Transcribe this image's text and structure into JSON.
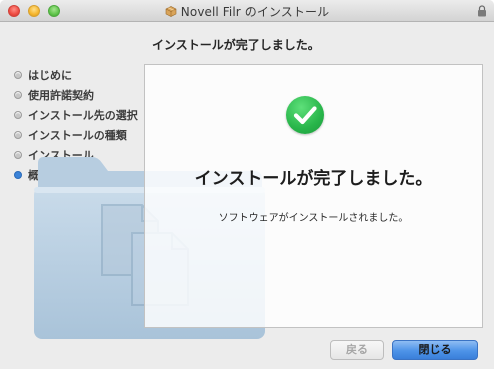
{
  "window": {
    "title": "Novell Filr のインストール",
    "icons": {
      "app": "package-icon",
      "lock": "lock-icon"
    }
  },
  "main": {
    "heading": "インストールが完了しました。",
    "completion_title": "インストールが完了しました。",
    "completion_message": "ソフトウェアがインストールされました。",
    "status_icon": "checkmark-icon"
  },
  "sidebar": {
    "steps": [
      {
        "label": "はじめに",
        "active": false
      },
      {
        "label": "使用許諾契約",
        "active": false
      },
      {
        "label": "インストール先の選択",
        "active": false
      },
      {
        "label": "インストールの種類",
        "active": false
      },
      {
        "label": "インストール",
        "active": false
      },
      {
        "label": "概要",
        "active": true
      }
    ]
  },
  "buttons": {
    "back_label": "戻る",
    "close_label": "閉じる"
  },
  "colors": {
    "accent": "#3b83d8",
    "success": "#28b54a"
  }
}
